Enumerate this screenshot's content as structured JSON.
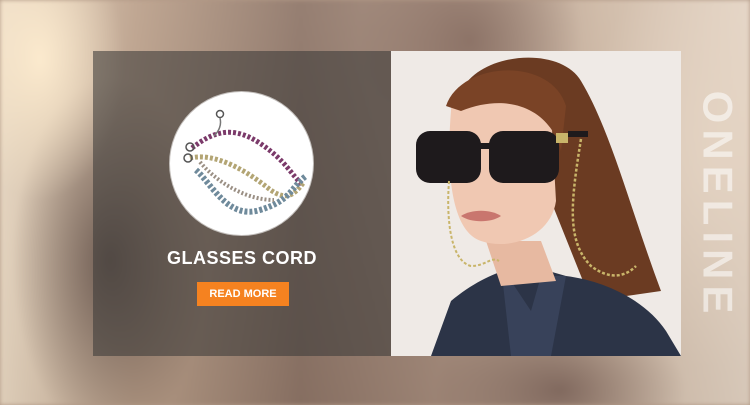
{
  "banner": {
    "headline": "GLASSES CORD",
    "cta_label": "READ MORE",
    "brand_text": "ONELINE"
  },
  "colors": {
    "accent": "#f58220",
    "panel_overlay": "#3c3a38",
    "text": "#ffffff"
  },
  "icons": {
    "product": "glasses-cord-product-image",
    "model": "model-with-sunglasses-photo"
  }
}
